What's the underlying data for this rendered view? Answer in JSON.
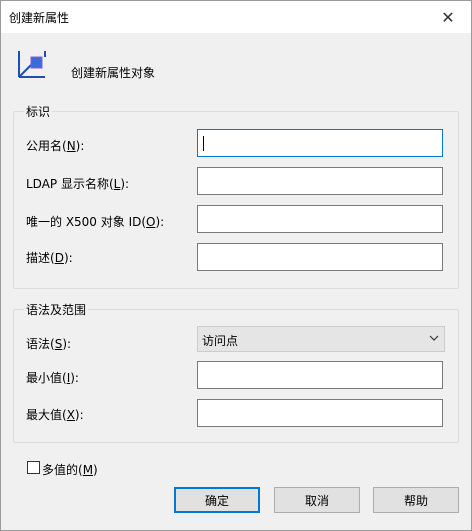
{
  "window": {
    "title": "创建新属性",
    "close_glyph": "✕"
  },
  "header": {
    "icon": "attribute-icon",
    "text": "创建新属性对象"
  },
  "identity_group": {
    "legend": "标识",
    "fields": [
      {
        "label_pre": "公用名(",
        "mnemonic": "N",
        "label_post": "):",
        "value": ""
      },
      {
        "label_pre": "LDAP 显示名称(",
        "mnemonic": "L",
        "label_post": "):",
        "value": ""
      },
      {
        "label_pre": "唯一的 X500 对象 ID(",
        "mnemonic": "O",
        "label_post": "):",
        "value": ""
      },
      {
        "label_pre": "描述(",
        "mnemonic": "D",
        "label_post": "):",
        "value": ""
      }
    ]
  },
  "syntax_group": {
    "legend": "语法及范围",
    "syntax": {
      "label_pre": "语法(",
      "mnemonic": "S",
      "label_post": "):",
      "selected": "访问点"
    },
    "min": {
      "label_pre": "最小值(",
      "mnemonic": "I",
      "label_post": "):",
      "value": ""
    },
    "max": {
      "label_pre": "最大值(",
      "mnemonic": "X",
      "label_post": "):",
      "value": ""
    }
  },
  "multivalued": {
    "label_pre": "多值的(",
    "mnemonic": "M",
    "label_post": ")",
    "checked": false
  },
  "buttons": {
    "ok": "确定",
    "cancel": "取消",
    "help": "帮助"
  },
  "colors": {
    "accent": "#0078d7",
    "background": "#f0f0f0"
  }
}
